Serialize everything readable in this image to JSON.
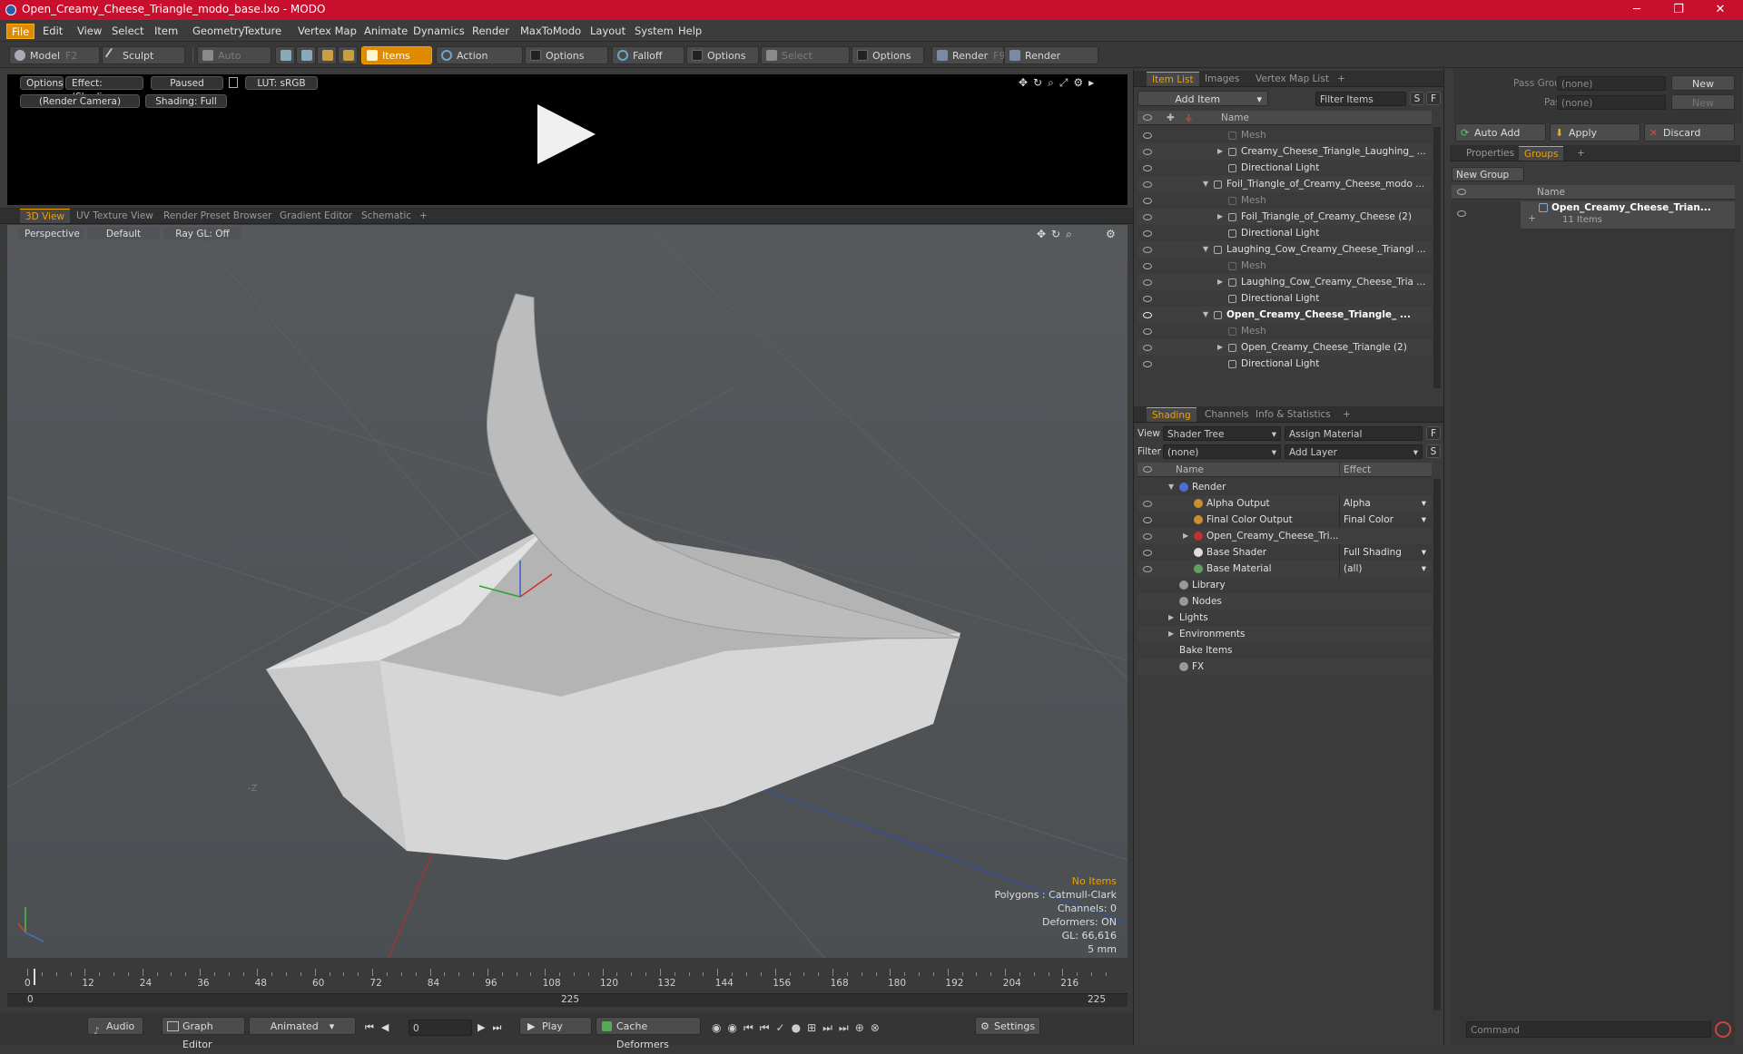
{
  "app": {
    "title": "Open_Creamy_Cheese_Triangle_modo_base.lxo - MODO"
  },
  "window": {
    "min": "─",
    "max": "❐",
    "close": "✕"
  },
  "menu": [
    "File",
    "Edit",
    "View",
    "Select",
    "Item",
    "Geometry",
    "Texture",
    "Vertex Map",
    "Animate",
    "Dynamics",
    "Render",
    "MaxToModo",
    "Layout",
    "System",
    "Help"
  ],
  "toolbar": {
    "model": "Model",
    "model_key": "F2",
    "sculpt": "Sculpt",
    "auto_select": "Auto Select",
    "items": "Items",
    "action_center": "Action Center",
    "options1": "Options",
    "falloff": "Falloff",
    "options2": "Options",
    "select_through": "Select Through",
    "options3": "Options",
    "render": "Render",
    "render_key": "F9",
    "render_window": "Render Window"
  },
  "preview": {
    "options": "Options",
    "effect": "Effect: (Shadi...",
    "paused": "Paused",
    "lut": "LUT: sRGB",
    "camera": "(Render Camera)",
    "shading": "Shading: Full"
  },
  "viewport_tabs": [
    "3D View",
    "UV Texture View",
    "Render Preset Browser",
    "Gradient Editor",
    "Schematic",
    "+"
  ],
  "viewport": {
    "projection": "Perspective",
    "style": "Default",
    "raygl": "Ray GL: Off",
    "axis_label": "-Z",
    "info": {
      "items": "No Items",
      "polygons": "Polygons : Catmull-Clark",
      "channels": "Channels: 0",
      "deformers": "Deformers: ON",
      "gl": "GL: 66,616",
      "scale": "5 mm"
    }
  },
  "timeline": {
    "ticks": [
      "0",
      "12",
      "24",
      "36",
      "48",
      "60",
      "72",
      "84",
      "96",
      "108",
      "120",
      "132",
      "144",
      "156",
      "168",
      "180",
      "192",
      "204",
      "216"
    ],
    "start": "0",
    "mid": "225",
    "end": "225"
  },
  "bottombar": {
    "audio": "Audio",
    "graph_editor": "Graph Editor",
    "animated": "Animated",
    "frame": "0",
    "play": "Play",
    "cache": "Cache Deformers",
    "settings": "Settings"
  },
  "itemlist": {
    "tabs": [
      "Item List",
      "Images",
      "Vertex Map List",
      "+"
    ],
    "add_item": "Add Item",
    "filter": "Filter Items",
    "s": "S",
    "f": "F",
    "col_name": "Name",
    "rows": [
      {
        "label": "Mesh",
        "indent": 2,
        "dim": true,
        "arrow": ""
      },
      {
        "label": "Creamy_Cheese_Triangle_Laughing_ ...",
        "indent": 2,
        "dim": false,
        "arrow": "▶"
      },
      {
        "label": "Directional Light",
        "indent": 2,
        "dim": false,
        "arrow": ""
      },
      {
        "label": "Foil_Triangle_of_Creamy_Cheese_modo ...",
        "indent": 1,
        "dim": false,
        "arrow": "▼"
      },
      {
        "label": "Mesh",
        "indent": 2,
        "dim": true,
        "arrow": ""
      },
      {
        "label": "Foil_Triangle_of_Creamy_Cheese (2)",
        "indent": 2,
        "dim": false,
        "arrow": "▶"
      },
      {
        "label": "Directional Light",
        "indent": 2,
        "dim": false,
        "arrow": ""
      },
      {
        "label": "Laughing_Cow_Creamy_Cheese_Triangl ...",
        "indent": 1,
        "dim": false,
        "arrow": "▼"
      },
      {
        "label": "Mesh",
        "indent": 2,
        "dim": true,
        "arrow": ""
      },
      {
        "label": "Laughing_Cow_Creamy_Cheese_Tria ...",
        "indent": 2,
        "dim": false,
        "arrow": "▶"
      },
      {
        "label": "Directional Light",
        "indent": 2,
        "dim": false,
        "arrow": ""
      },
      {
        "label": "Open_Creamy_Cheese_Triangle_ ...",
        "indent": 1,
        "dim": false,
        "arrow": "▼",
        "bold": true
      },
      {
        "label": "Mesh",
        "indent": 2,
        "dim": true,
        "arrow": ""
      },
      {
        "label": "Open_Creamy_Cheese_Triangle (2)",
        "indent": 2,
        "dim": false,
        "arrow": "▶"
      },
      {
        "label": "Directional Light",
        "indent": 2,
        "dim": false,
        "arrow": ""
      }
    ]
  },
  "shading": {
    "tabs": [
      "Shading",
      "Channels",
      "Info & Statistics",
      "+"
    ],
    "view_label": "View",
    "view_value": "Shader Tree",
    "assign": "Assign Material",
    "filter_label": "Filter",
    "filter_value": "(none)",
    "add_layer": "Add Layer",
    "f": "F",
    "s": "S",
    "col_name": "Name",
    "col_effect": "Effect",
    "rows": [
      {
        "name": "Render",
        "effect": "",
        "indent": 0,
        "arrow": "▼",
        "eye": false,
        "icon": "#4a6fd8"
      },
      {
        "name": "Alpha Output",
        "effect": "Alpha",
        "indent": 1,
        "arrow": "",
        "eye": true,
        "icon": "#c89030"
      },
      {
        "name": "Final Color Output",
        "effect": "Final Color",
        "indent": 1,
        "arrow": "",
        "eye": true,
        "icon": "#c89030"
      },
      {
        "name": "Open_Creamy_Cheese_Tri...",
        "effect": "",
        "indent": 1,
        "arrow": "▶",
        "eye": true,
        "icon": "#c03030"
      },
      {
        "name": "Base Shader",
        "effect": "Full Shading",
        "indent": 1,
        "arrow": "",
        "eye": true,
        "icon": "#dddddd"
      },
      {
        "name": "Base Material",
        "effect": "(all)",
        "indent": 1,
        "arrow": "",
        "eye": true,
        "icon": "#60a060"
      },
      {
        "name": "Library",
        "effect": "",
        "indent": 0,
        "arrow": "",
        "eye": false,
        "icon": "#999999"
      },
      {
        "name": "Nodes",
        "effect": "",
        "indent": 0,
        "arrow": "",
        "eye": false,
        "icon": "#999999"
      },
      {
        "name": "Lights",
        "effect": "",
        "indent": 0,
        "arrow": "▶",
        "eye": false,
        "icon": ""
      },
      {
        "name": "Environments",
        "effect": "",
        "indent": 0,
        "arrow": "▶",
        "eye": false,
        "icon": ""
      },
      {
        "name": "Bake Items",
        "effect": "",
        "indent": 0,
        "arrow": "",
        "eye": false,
        "icon": ""
      },
      {
        "name": "FX",
        "effect": "",
        "indent": 0,
        "arrow": "",
        "eye": false,
        "icon": "#999999"
      }
    ]
  },
  "groups": {
    "pass_groups": "Pass Groups",
    "pass_value": "(none)",
    "passes": "Passes",
    "passes_value": "(none)",
    "new1": "New",
    "new2": "New",
    "auto_add": "Auto Add",
    "apply": "Apply",
    "discard": "Discard",
    "tabs": [
      "Properties",
      "Groups",
      "+"
    ],
    "new_group": "New Group",
    "col_name": "Name",
    "item_name": "Open_Creamy_Cheese_Trian...",
    "item_count": "11 Items"
  },
  "command": {
    "placeholder": "Command"
  }
}
